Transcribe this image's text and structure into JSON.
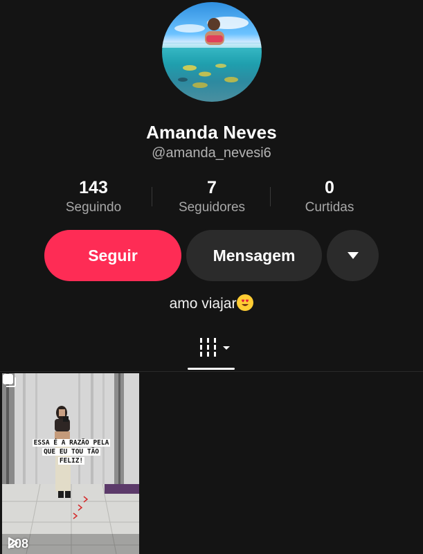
{
  "profile": {
    "name": "Amanda Neves",
    "handle": "@amanda_nevesi6",
    "bio": "amo viajar"
  },
  "stats": [
    {
      "value": "143",
      "label": "Seguindo"
    },
    {
      "value": "7",
      "label": "Seguidores"
    },
    {
      "value": "0",
      "label": "Curtidas"
    }
  ],
  "actions": {
    "follow_label": "Seguir",
    "message_label": "Mensagem"
  },
  "videos": [
    {
      "caption_line1": "ESSA É A RAZÃO PELA",
      "caption_line2": "QUE EU TOU TÃO",
      "caption_line3": "FELIZ!",
      "views": "208"
    }
  ],
  "icons": {
    "bio_emoji": "heart-eyes-emoji-icon",
    "tab": "grid-posts-icon",
    "dropdown": "chevron-down-icon",
    "views": "play-icon",
    "multi": "multiple-images-icon"
  },
  "colors": {
    "accent": "#fe2c55",
    "background": "#141414",
    "secondary_button": "#2b2b2b"
  }
}
